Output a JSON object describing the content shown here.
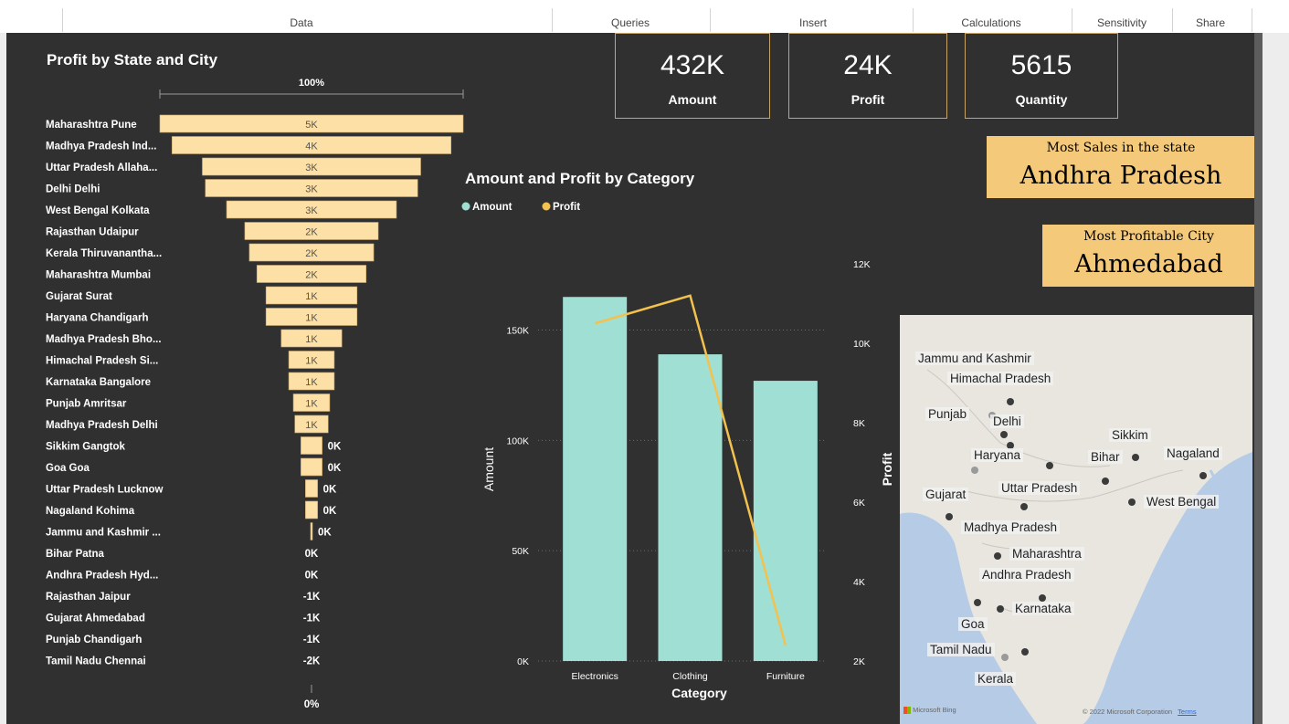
{
  "ribbon": {
    "groups": [
      "Data",
      "Queries",
      "Insert",
      "Calculations",
      "Sensitivity",
      "Share"
    ]
  },
  "kpis": [
    {
      "value": "432K",
      "label": "Amount"
    },
    {
      "value": "24K",
      "label": "Profit"
    },
    {
      "value": "5615",
      "label": "Quantity"
    }
  ],
  "cards": {
    "sales": {
      "caption": "Most Sales in the state",
      "value": "Andhra Pradesh"
    },
    "profit": {
      "caption": "Most Profitable City",
      "value": "Ahmedabad"
    }
  },
  "map": {
    "labels": [
      "Jammu and Kashmir",
      "Himachal Pradesh",
      "Punjab",
      "Delhi",
      "Haryana",
      "Sikkim",
      "Bihar",
      "Nagaland",
      "Uttar Pradesh",
      "Gujarat",
      "West Bengal",
      "Madhya Pradesh",
      "Maharashtra",
      "Andhra Pradesh",
      "Karnataka",
      "Goa",
      "Tamil Nadu",
      "Kerala"
    ],
    "logo_text": "Microsoft Bing",
    "copyright": "© 2022 Microsoft Corporation",
    "terms": "Terms"
  },
  "chart_data": [
    {
      "type": "bar",
      "subtype": "funnel",
      "title": "Profit by State and City",
      "top_label": "100%",
      "bottom_label": "0%",
      "categories": [
        "Maharashtra Pune",
        "Madhya Pradesh Ind...",
        "Uttar Pradesh Allaha...",
        "Delhi Delhi",
        "West Bengal Kolkata",
        "Rajasthan Udaipur",
        "Kerala Thiruvanantha...",
        "Maharashtra Mumbai",
        "Gujarat Surat",
        "Haryana Chandigarh",
        "Madhya Pradesh Bho...",
        "Himachal Pradesh Si...",
        "Karnataka Bangalore",
        "Punjab Amritsar",
        "Madhya Pradesh Delhi",
        "Sikkim Gangtok",
        "Goa Goa",
        "Uttar Pradesh Lucknow",
        "Nagaland Kohima",
        "Jammu and Kashmir ...",
        "Bihar Patna",
        "Andhra Pradesh Hyd...",
        "Rajasthan Jaipur",
        "Gujarat Ahmedabad",
        "Punjab Chandigarh",
        "Tamil Nadu Chennai"
      ],
      "values": [
        5000,
        4600,
        3600,
        3500,
        2800,
        2200,
        2050,
        1800,
        1500,
        1500,
        1000,
        750,
        750,
        600,
        550,
        350,
        350,
        200,
        200,
        30,
        0,
        0,
        -1000,
        -1000,
        -1000,
        -2000
      ],
      "data_labels": [
        "5K",
        "4K",
        "3K",
        "3K",
        "3K",
        "2K",
        "2K",
        "2K",
        "1K",
        "1K",
        "1K",
        "1K",
        "1K",
        "1K",
        "1K",
        "0K",
        "0K",
        "0K",
        "0K",
        "0K",
        "0K",
        "0K",
        "-1K",
        "-1K",
        "-1K",
        "-2K"
      ],
      "color": "#fde0a5"
    },
    {
      "type": "bar",
      "subtype": "combo-line",
      "title": "Amount and Profit by Category",
      "xlabel": "Category",
      "ylabel": "Amount",
      "ylabel2": "Profit",
      "categories": [
        "Electronics",
        "Clothing",
        "Furniture"
      ],
      "series": [
        {
          "name": "Amount",
          "type": "bar",
          "axis": "left",
          "values": [
            165000,
            139000,
            127000
          ],
          "color": "#a0e0d4"
        },
        {
          "name": "Profit",
          "type": "line",
          "axis": "right",
          "values": [
            10500,
            11200,
            2400
          ],
          "color": "#f2c14e"
        }
      ],
      "ylim": [
        0,
        180000
      ],
      "yticks": [
        0,
        50000,
        100000,
        150000
      ],
      "ytick_labels": [
        "0K",
        "50K",
        "100K",
        "150K"
      ],
      "y2lim": [
        2000,
        12000
      ],
      "y2ticks": [
        2000,
        4000,
        6000,
        8000,
        10000,
        12000
      ],
      "y2tick_labels": [
        "2K",
        "4K",
        "6K",
        "8K",
        "10K",
        "12K"
      ],
      "grid": true,
      "legend": "top-left"
    }
  ]
}
